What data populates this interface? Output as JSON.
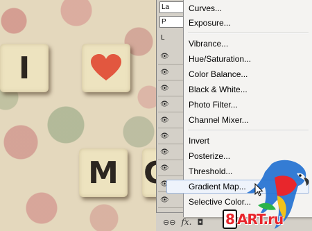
{
  "canvas": {
    "tiles": {
      "i": "I",
      "m": "M",
      "partial": "C"
    }
  },
  "layers_panel": {
    "top_field_text": "La",
    "second_field_text": "P",
    "third_label": "L"
  },
  "adjustment_menu": {
    "items": [
      "Curves...",
      "Exposure...",
      "Vibrance...",
      "Hue/Saturation...",
      "Color Balance...",
      "Black & White...",
      "Photo Filter...",
      "Channel Mixer...",
      "Invert",
      "Posterize...",
      "Threshold...",
      "Gradient Map...",
      "Selective Color..."
    ],
    "highlighted_item": "Gradient Map..."
  },
  "bottom_toolbar": {
    "link_label": "⊖⊖",
    "fx_label": "fx."
  },
  "watermark": {
    "prefix": "8",
    "brand": "ART.ru"
  },
  "colors": {
    "heart": "#e2573f",
    "menu_hover_bg": "#eef3fb",
    "menu_hover_border": "#9cb7e0",
    "watermark_red": "#e8262c"
  }
}
